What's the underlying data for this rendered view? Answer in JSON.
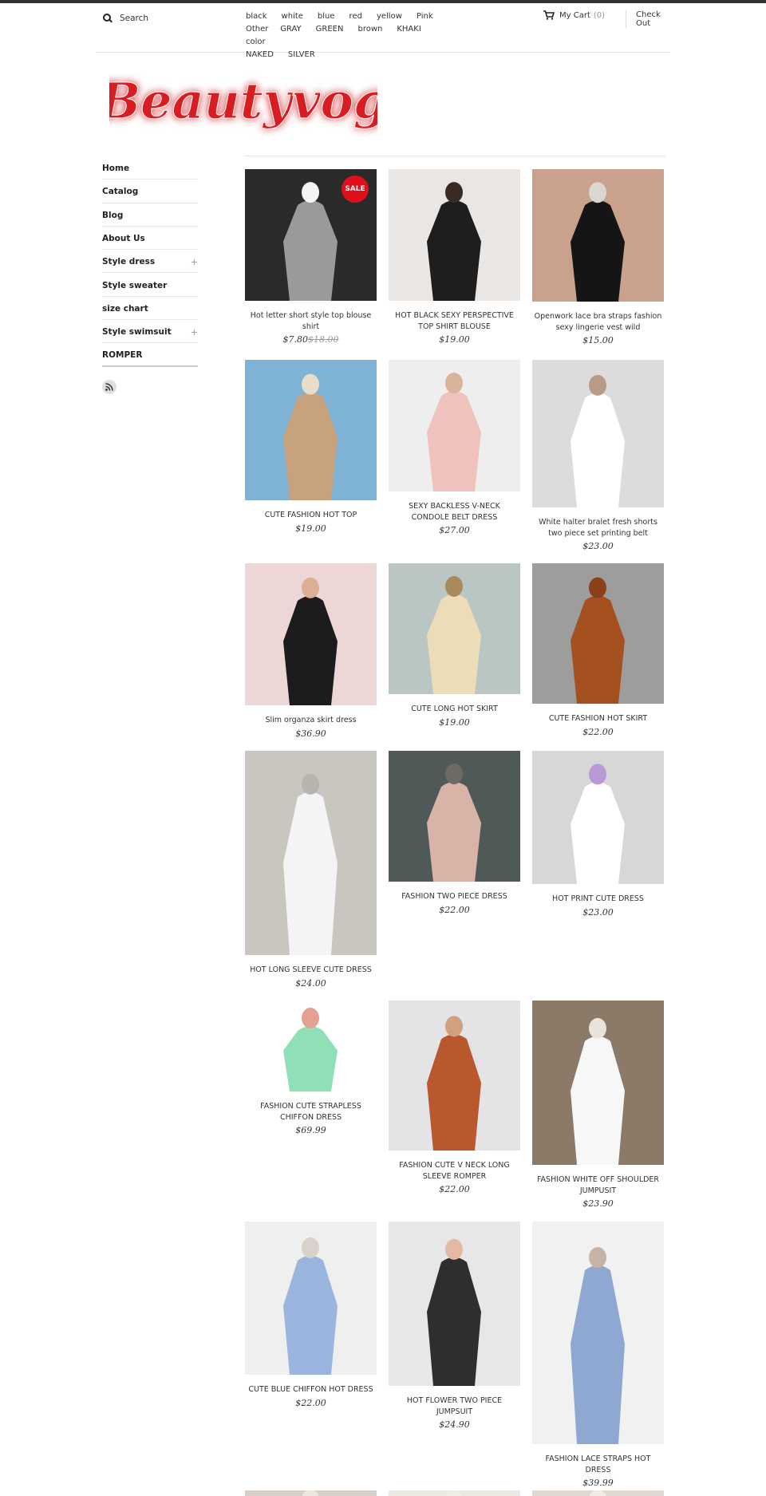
{
  "header": {
    "search_placeholder": "Search",
    "colors": [
      "black",
      "white",
      "blue",
      "red",
      "yellow",
      "Pink",
      "Other color",
      "GRAY",
      "GREEN",
      "brown",
      "KHAKI",
      "NAKED",
      "SILVER"
    ],
    "cart_label": "My Cart",
    "cart_count": "(0)",
    "checkout_label": "Check Out"
  },
  "logo": {
    "text": "Beautyvog"
  },
  "sidebar": {
    "items": [
      {
        "label": "Home",
        "expand": ""
      },
      {
        "label": "Catalog",
        "expand": ""
      },
      {
        "label": "Blog",
        "expand": ""
      },
      {
        "label": "About Us",
        "expand": ""
      },
      {
        "label": "Style dress",
        "expand": "+"
      },
      {
        "label": "Style sweater",
        "expand": ""
      },
      {
        "label": "size chart",
        "expand": ""
      },
      {
        "label": "Style swimsuit",
        "expand": "+"
      },
      {
        "label": "ROMPER",
        "expand": ""
      }
    ]
  },
  "sale_badge": "SALE",
  "products": [
    {
      "name": "Hot letter short style top blouse shirt",
      "price": "$7.80",
      "old_price": "$18.00",
      "colors": [
        "#2a2a2a",
        "#9a9a9a",
        "#f4f4f4"
      ]
    },
    {
      "name": "HOT BLACK SEXY PERSPECTIVE TOP SHIRT BLOUSE",
      "price": "$19.00",
      "old_price": "",
      "colors": [
        "#e9e6e3",
        "#1e1e1e",
        "#3a2a25"
      ]
    },
    {
      "name": "Openwork lace bra straps fashion sexy lingerie vest wild",
      "price": "$15.00",
      "old_price": "",
      "colors": [
        "#c9a18d",
        "#151515",
        "#dcd6d0"
      ]
    },
    {
      "name": "CUTE FASHION HOT TOP",
      "price": "$19.00",
      "old_price": "",
      "colors": [
        "#7fb3d6",
        "#c7a27d",
        "#e8dccb"
      ]
    },
    {
      "name": "SEXY BACKLESS V-NECK CONDOLE BELT DRESS",
      "price": "$27.00",
      "old_price": "",
      "colors": [
        "#eeeeee",
        "#efc2bd",
        "#d9b39a"
      ]
    },
    {
      "name": "White halter bralet fresh shorts two piece set printing belt",
      "price": "$23.00",
      "old_price": "",
      "colors": [
        "#dcdcdc",
        "#ffffff",
        "#b79b86"
      ]
    },
    {
      "name": "Slim organza skirt dress",
      "price": "$36.90",
      "old_price": "",
      "colors": [
        "#ecd6d6",
        "#1c1c1c",
        "#dcae93"
      ]
    },
    {
      "name": "CUTE LONG HOT SKIRT",
      "price": "$19.00",
      "old_price": "",
      "colors": [
        "#b9c6c3",
        "#ecdcb8",
        "#a98a5b"
      ]
    },
    {
      "name": "CUTE FASHION HOT SKIRT",
      "price": "$22.00",
      "old_price": "",
      "colors": [
        "#9d9d9d",
        "#a4501f",
        "#8a4019"
      ]
    },
    {
      "name": "HOT LONG SLEEVE CUTE DRESS",
      "price": "$24.00",
      "old_price": "",
      "colors": [
        "#c9c5bf",
        "#f4f4f4",
        "#b8b3ad"
      ]
    },
    {
      "name": "FASHION TWO PIECE DRESS",
      "price": "$22.00",
      "old_price": "",
      "colors": [
        "#4f5a58",
        "#d9b3a8",
        "#6d6a64"
      ]
    },
    {
      "name": "HOT PRINT CUTE DRESS",
      "price": "$23.00",
      "old_price": "",
      "colors": [
        "#d7d7d7",
        "#ffffff",
        "#b99ad6"
      ]
    },
    {
      "name": "FASHION CUTE STRAPLESS CHIFFON DRESS",
      "price": "$69.99",
      "old_price": "",
      "colors": [
        "#ffffff",
        "#8fe0b6",
        "#e3a191"
      ]
    },
    {
      "name": "FASHION CUTE V NECK LONG SLEEVE ROMPER",
      "price": "$22.00",
      "old_price": "",
      "colors": [
        "#e4e4e6",
        "#b8582c",
        "#d0a07f"
      ]
    },
    {
      "name": "FASHION WHITE OFF SHOULDER JUMPUSIT",
      "price": "$23.90",
      "old_price": "",
      "colors": [
        "#8c7a68",
        "#f7f7f7",
        "#e9e3d9"
      ]
    },
    {
      "name": "CUTE BLUE CHIFFON HOT DRESS",
      "price": "$22.00",
      "old_price": "",
      "colors": [
        "#efefef",
        "#9ab6df",
        "#d8d2cb"
      ]
    },
    {
      "name": "HOT FLOWER TWO PIECE JUMPSUIT",
      "price": "$24.90",
      "old_price": "",
      "colors": [
        "#e7e7e7",
        "#2e2e2e",
        "#e4b9a4"
      ]
    },
    {
      "name": "FASHION LACE STRAPS HOT DRESS",
      "price": "$39.99",
      "old_price": "",
      "colors": [
        "#f1f1f1",
        "#8fa8d2",
        "#c7b3a3"
      ]
    },
    {
      "name": "",
      "price": "",
      "old_price": "",
      "colors": [
        "#d8d0c8",
        "#a88a74",
        "#ece6df"
      ]
    },
    {
      "name": "",
      "price": "",
      "old_price": "",
      "colors": [
        "#eee8e2",
        "#d2b89a",
        "#f1ece6"
      ]
    },
    {
      "name": "",
      "price": "",
      "old_price": "",
      "colors": [
        "#e0d8d0",
        "#c8a488",
        "#f0ebe6"
      ]
    }
  ]
}
